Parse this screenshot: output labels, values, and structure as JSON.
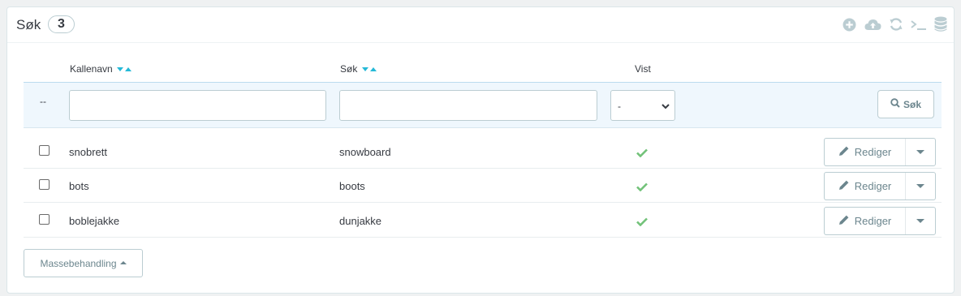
{
  "header": {
    "title": "Søk",
    "count": "3",
    "toolbar_icons": [
      "add-icon",
      "cloud-upload-icon",
      "refresh-icon",
      "terminal-icon",
      "database-icon"
    ]
  },
  "table": {
    "columns": [
      "Kallenavn",
      "Søk",
      "Vist"
    ],
    "filter": {
      "bulk_placeholder": "--",
      "vist_selected": "-",
      "search_button": "Søk"
    },
    "rows": [
      {
        "alias": "snobrett",
        "search": "snowboard",
        "shown": true,
        "action": "Rediger"
      },
      {
        "alias": "bots",
        "search": "boots",
        "shown": true,
        "action": "Rediger"
      },
      {
        "alias": "boblejakke",
        "search": "dunjakke",
        "shown": true,
        "action": "Rediger"
      }
    ]
  },
  "footer": {
    "bulk_actions": "Massebehandling"
  },
  "colors": {
    "accent": "#25b9d7",
    "check_green": "#72c279",
    "icon_grey": "#bbcdd2",
    "button_text": "#6c868e"
  }
}
